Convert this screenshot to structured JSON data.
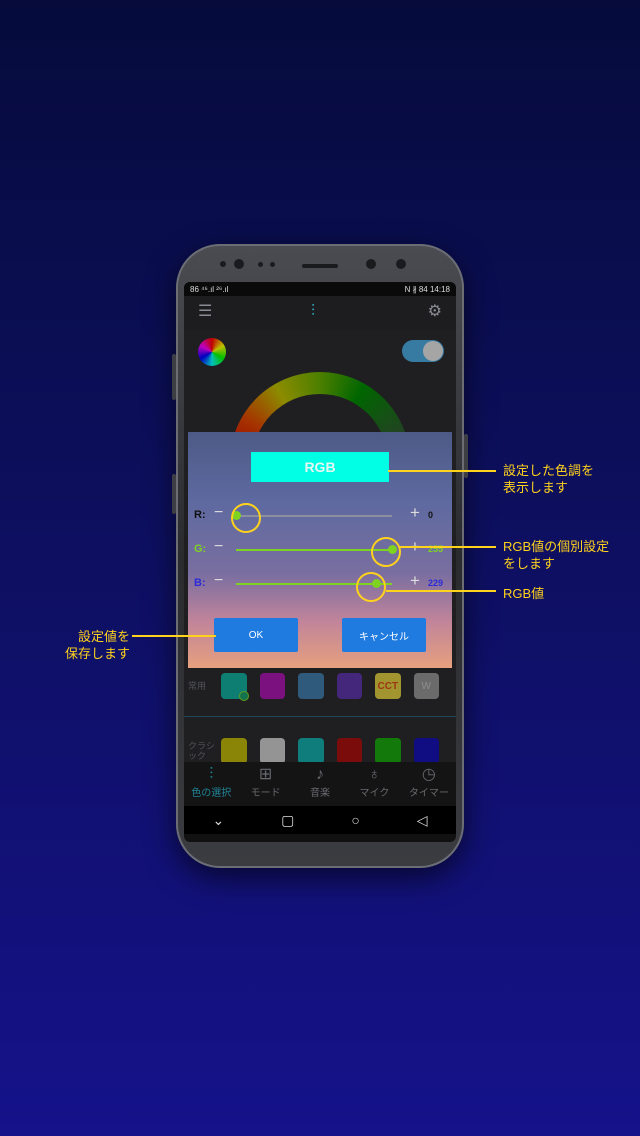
{
  "statusbar": {
    "left": "86 ⁴⁶.ıl ²⁶.ıl",
    "right": "N ∦ 84 14:18"
  },
  "app": {
    "presets": {
      "common_label": "常用",
      "classic_label": "クラシック",
      "common": [
        {
          "color": "#13a99a",
          "text": ""
        },
        {
          "color": "#a417a8",
          "text": ""
        },
        {
          "color": "#3f78a6",
          "text": ""
        },
        {
          "color": "#5b33a3",
          "text": ""
        },
        {
          "color": "#d8c63f",
          "text": "CCT"
        },
        {
          "color": "#8f8f8f",
          "text": "W"
        }
      ],
      "classic": [
        {
          "color": "#b9b20a"
        },
        {
          "color": "#c6c6c6"
        },
        {
          "color": "#13a7a6"
        },
        {
          "color": "#a3100f"
        },
        {
          "color": "#1aa20f"
        },
        {
          "color": "#1512ad"
        }
      ]
    },
    "tabs": [
      {
        "icon": "sliders-icon",
        "label": "色の選択",
        "active": true
      },
      {
        "icon": "grid-icon",
        "label": "モード",
        "active": false
      },
      {
        "icon": "music-icon",
        "label": "音楽",
        "active": false
      },
      {
        "icon": "mic-icon",
        "label": "マイク",
        "active": false
      },
      {
        "icon": "timer-icon",
        "label": "タイマー",
        "active": false
      }
    ]
  },
  "dialog": {
    "title": "RGB",
    "sliders": [
      {
        "label": "R:",
        "value": "0",
        "color": "#111111",
        "level": 0
      },
      {
        "label": "G:",
        "value": "255",
        "color": "#7ed321",
        "level": 1
      },
      {
        "label": "B:",
        "value": "229",
        "color": "#2b2bd9",
        "level": 0.898
      }
    ],
    "ok_label": "OK",
    "cancel_label": "キャンセル"
  },
  "annotations": {
    "title_note": "設定した色調を\n表示します",
    "slider_note": "RGB値の個別設定\nをします",
    "value_note": "RGB値",
    "ok_note": "設定値を\n保存します"
  },
  "colors": {
    "accent": "#ffd21c",
    "button": "#1f7be0",
    "title_bg": "#00ffe5"
  }
}
